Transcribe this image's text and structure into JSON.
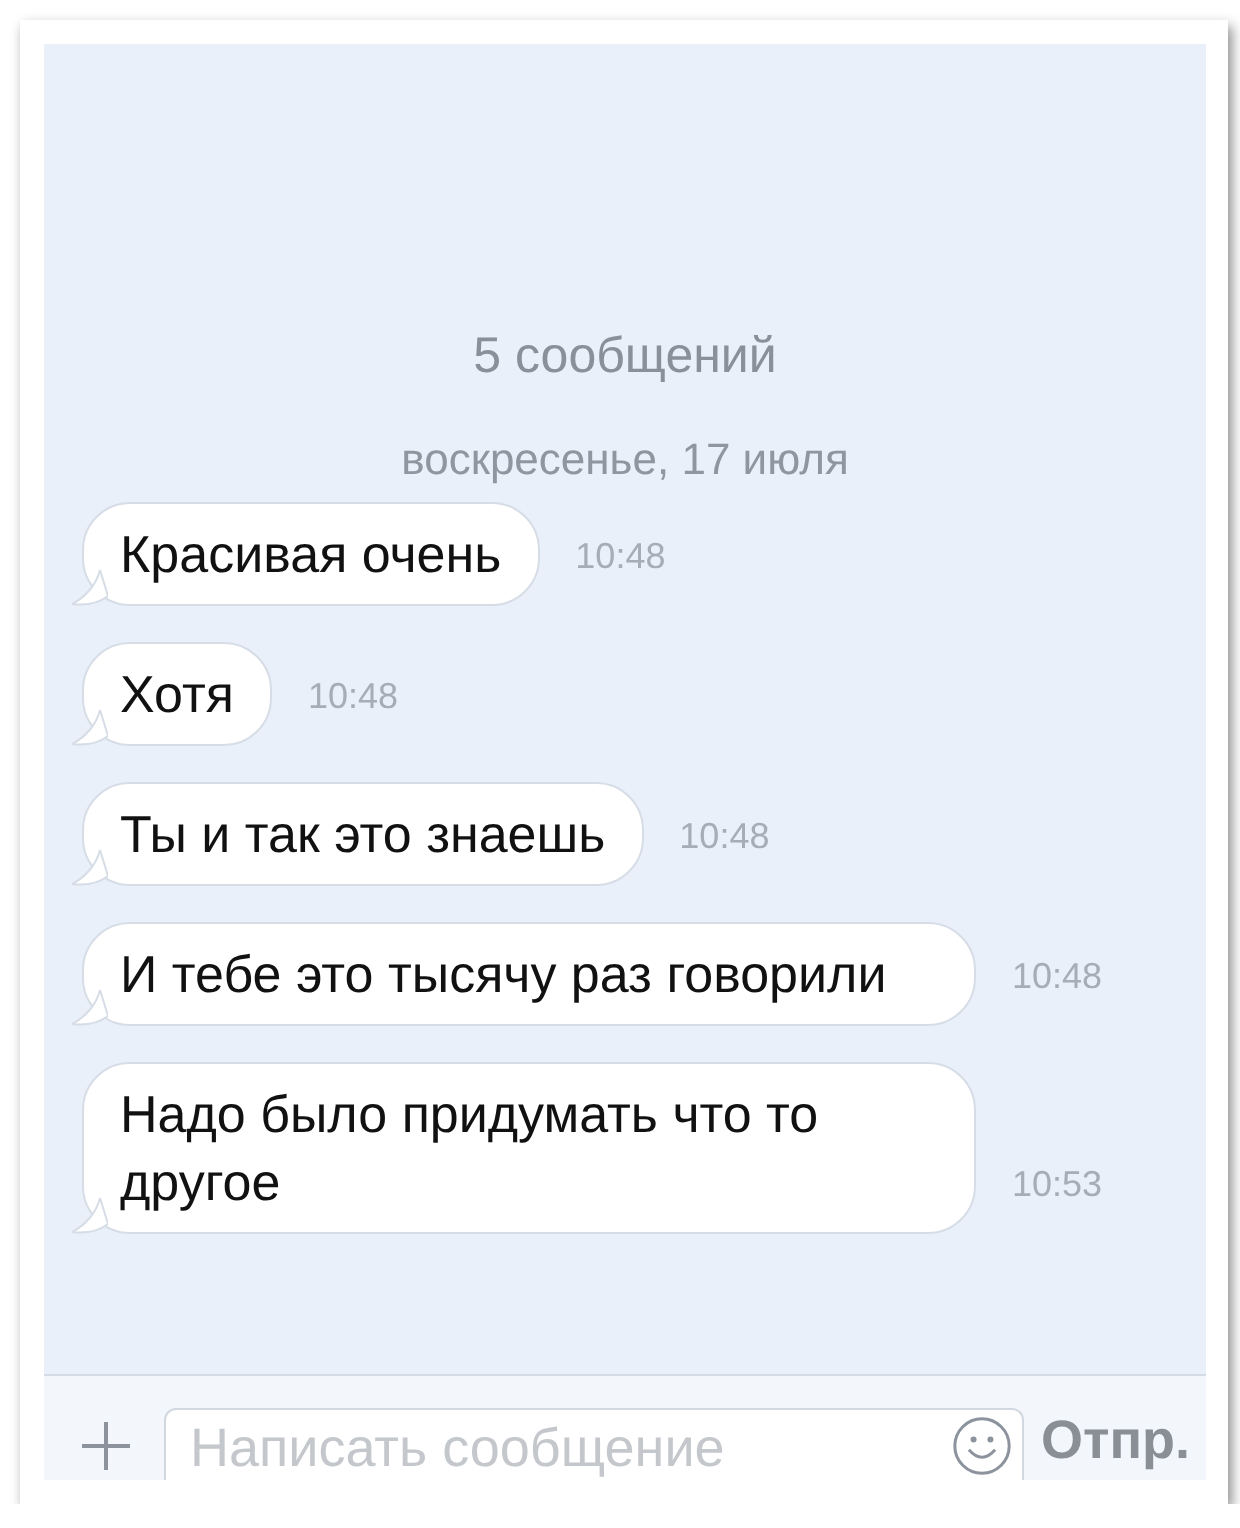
{
  "chat": {
    "count": "5 сообщений",
    "date": "воскресенье, 17 июля",
    "messages": [
      {
        "text": "Красивая очень",
        "time": "10:48"
      },
      {
        "text": "Хотя",
        "time": "10:48"
      },
      {
        "text": "Ты и так это знаешь",
        "time": "10:48"
      },
      {
        "text": "И тебе это тысячу раз говорили",
        "time": "10:48"
      },
      {
        "text": "Надо было придумать что то другое",
        "time": "10:53"
      }
    ]
  },
  "composer": {
    "placeholder": "Написать сообщение",
    "send": "Отпр."
  }
}
